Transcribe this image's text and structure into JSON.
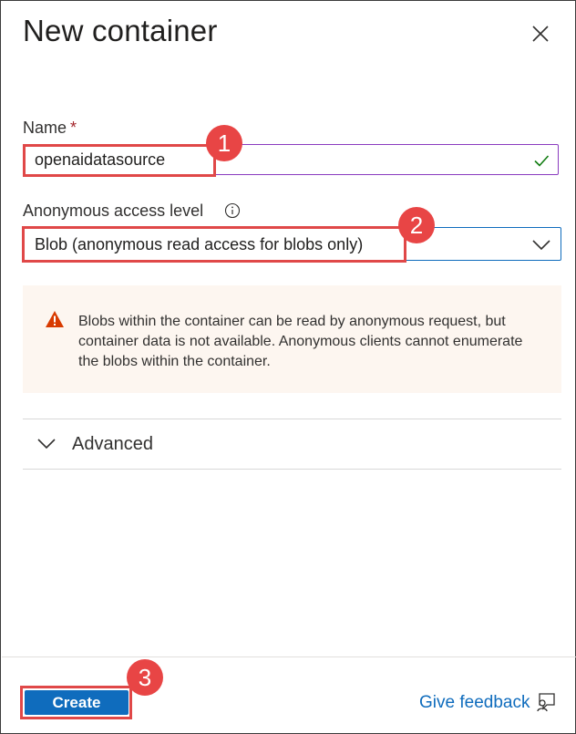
{
  "panel": {
    "title": "New container"
  },
  "form": {
    "name_label": "Name",
    "name_required": "*",
    "name_value": "openaidatasource",
    "access_label": "Anonymous access level",
    "access_value": "Blob (anonymous read access for blobs only)"
  },
  "warning": {
    "text": "Blobs within the container can be read by anonymous request, but container data is not available. Anonymous clients cannot enumerate the blobs within the container."
  },
  "advanced": {
    "label": "Advanced"
  },
  "footer": {
    "create_label": "Create",
    "feedback_label": "Give feedback"
  },
  "annotations": {
    "step1": "1",
    "step2": "2",
    "step3": "3"
  },
  "colors": {
    "accent": "#0f6cbd",
    "highlight": "#e04848",
    "valid": "#107c10",
    "warning_icon": "#d83b01"
  },
  "icons": [
    "close-icon",
    "checkmark-icon",
    "info-icon",
    "chevron-down-icon",
    "warning-icon",
    "feedback-icon"
  ]
}
